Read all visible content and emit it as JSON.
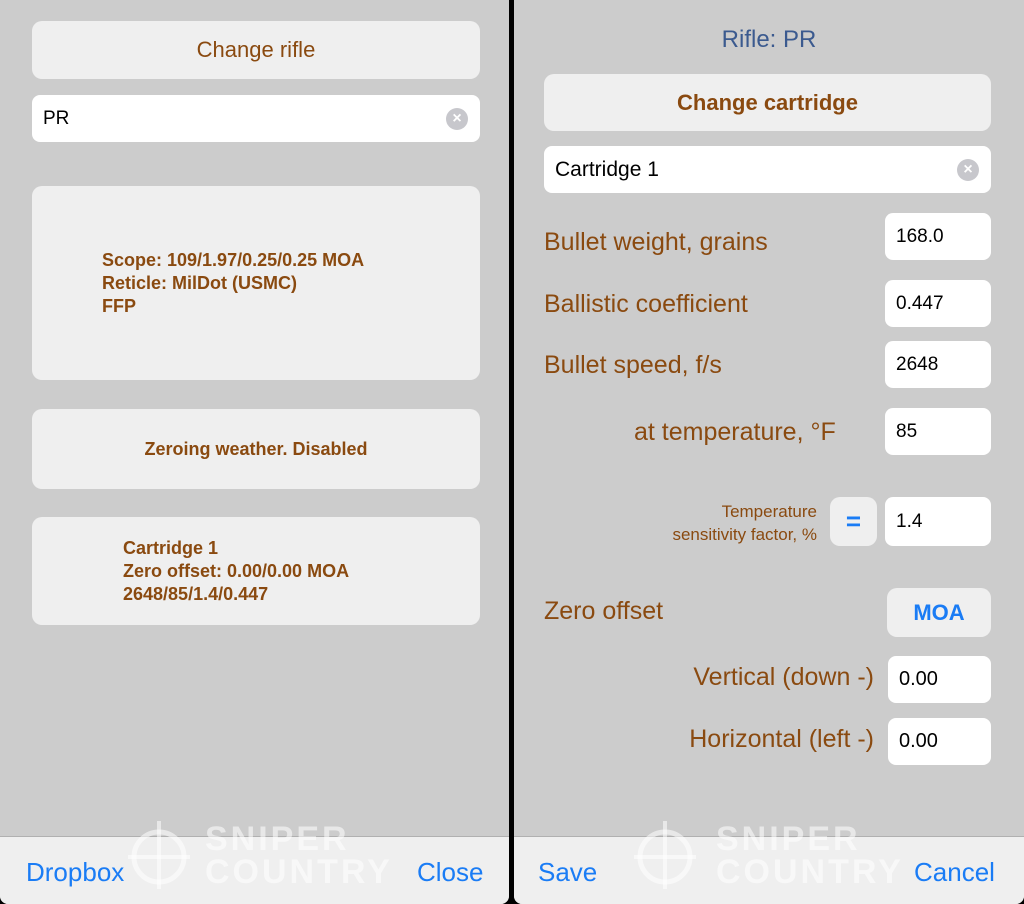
{
  "left": {
    "change_rifle": "Change rifle",
    "rifle_name": "PR",
    "scope_lines": [
      "Scope: 109/1.97/0.25/0.25 MOA",
      "Reticle: MilDot (USMC)",
      "FFP"
    ],
    "zeroing_weather": "Zeroing weather. Disabled",
    "cartridge_lines": [
      "Cartridge 1",
      "Zero offset: 0.00/0.00 MOA",
      "2648/85/1.4/0.447"
    ],
    "toolbar": {
      "left": "Dropbox",
      "right": "Close"
    }
  },
  "right": {
    "title": "Rifle: PR",
    "change_cartridge": "Change cartridge",
    "cartridge_name": "Cartridge 1",
    "fields": [
      {
        "label": "Bullet weight, grains",
        "value": "168.0"
      },
      {
        "label": "Ballistic coefficient",
        "value": "0.447"
      },
      {
        "label": "Bullet speed, f/s",
        "value": "2648"
      },
      {
        "label": "at temperature, °F",
        "value": "85"
      }
    ],
    "temp_sens": {
      "label_1": "Temperature",
      "label_2": "sensitivity factor, %",
      "button": "=",
      "value": "1.4"
    },
    "zero_offset": {
      "label": "Zero offset",
      "unit_button": "MOA",
      "vertical_label": "Vertical (down -)",
      "vertical_value": "0.00",
      "horizontal_label": "Horizontal (left -)",
      "horizontal_value": "0.00"
    },
    "toolbar": {
      "left": "Save",
      "right": "Cancel"
    }
  },
  "watermark": {
    "line1": "SNIPER",
    "line2": "COUNTRY"
  },
  "colors": {
    "accent": "#1a7cf5",
    "label": "#8a4a10",
    "background": "#cccccc"
  }
}
